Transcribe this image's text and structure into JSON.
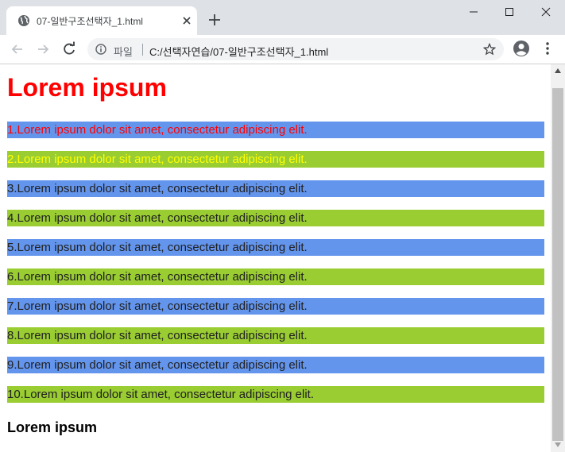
{
  "browser": {
    "tab_title": "07-일반구조선택자_1.html",
    "page_info_label": "파일",
    "url": "C:/선택자연습/07-일반구조선택자_1.html"
  },
  "page": {
    "title": "Lorem ipsum",
    "items": [
      "1.Lorem ipsum dolor sit amet, consectetur adipiscing elit.",
      "2.Lorem ipsum dolor sit amet, consectetur adipiscing elit.",
      "3.Lorem ipsum dolor sit amet, consectetur adipiscing elit.",
      "4.Lorem ipsum dolor sit amet, consectetur adipiscing elit.",
      "5.Lorem ipsum dolor sit amet, consectetur adipiscing elit.",
      "6.Lorem ipsum dolor sit amet, consectetur adipiscing elit.",
      "7.Lorem ipsum dolor sit amet, consectetur adipiscing elit.",
      "8.Lorem ipsum dolor sit amet, consectetur adipiscing elit.",
      "9.Lorem ipsum dolor sit amet, consectetur adipiscing elit.",
      "10.Lorem ipsum dolor sit amet, consectetur adipiscing elit."
    ],
    "subheading": "Lorem ipsum"
  },
  "colors": {
    "title": "#ff0000",
    "odd_row_background": "#6495ed",
    "even_row_background": "#9acd32",
    "item1_text": "#ff0000",
    "item2_text": "#ffff00"
  },
  "icons": {
    "tab_favicon": "globe-icon",
    "tab_close": "close-icon",
    "new_tab": "plus-icon",
    "back": "arrow-left-icon",
    "forward": "arrow-right-icon",
    "reload": "reload-icon",
    "page_info": "info-icon",
    "bookmark": "star-icon",
    "profile": "account-circle-icon",
    "menu": "kebab-menu-icon"
  }
}
